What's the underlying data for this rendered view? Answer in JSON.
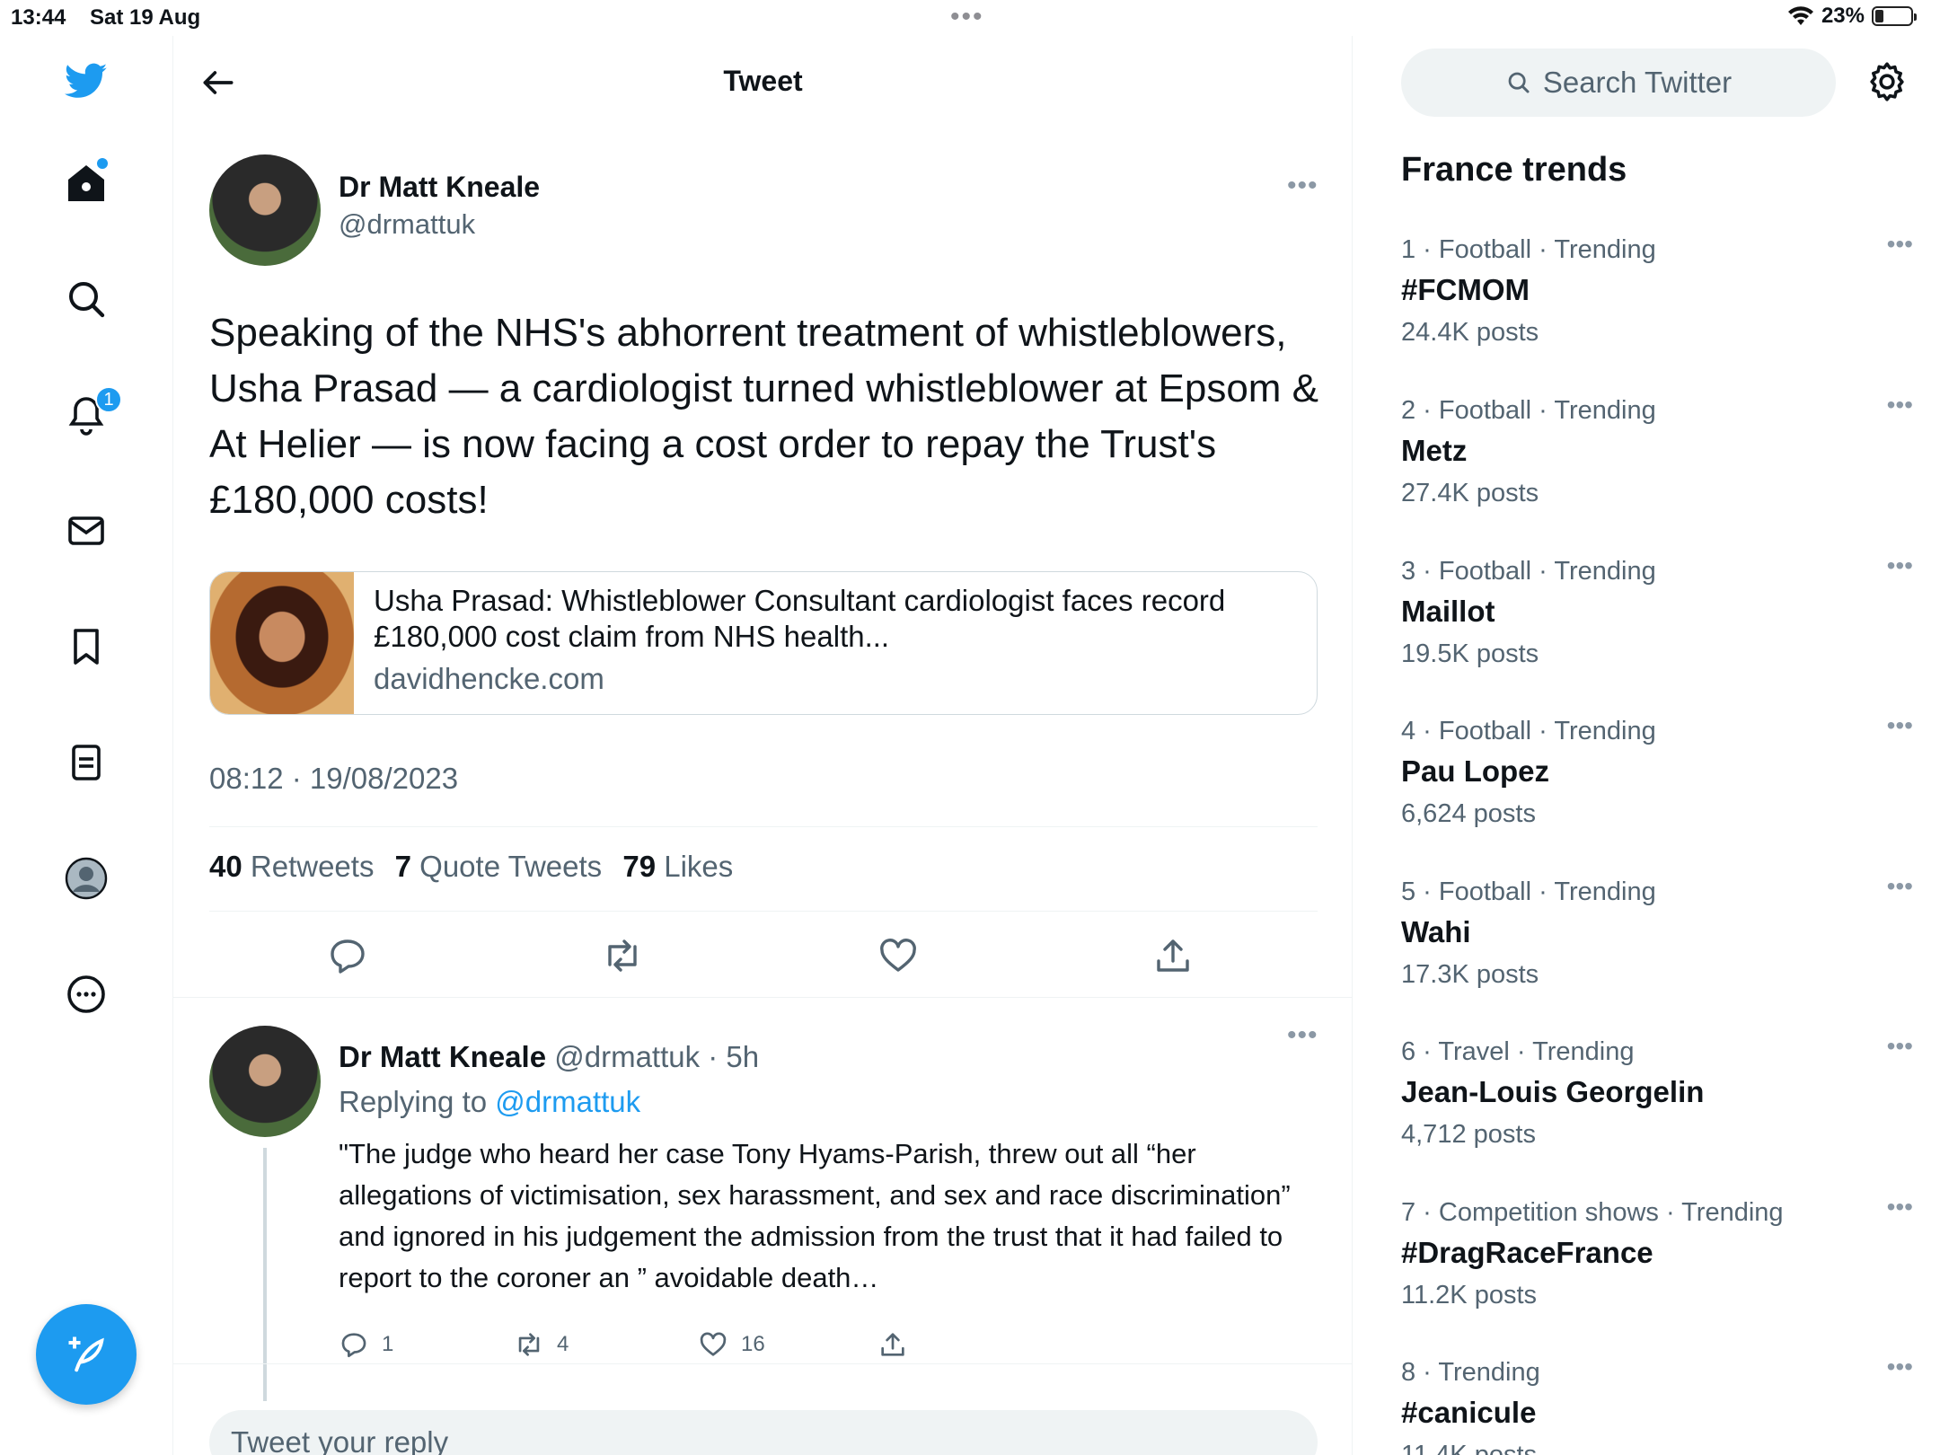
{
  "status_bar": {
    "time": "13:44",
    "date": "Sat 19 Aug",
    "battery": "23%",
    "battery_level": 0.23
  },
  "nav": {
    "notifications_badge": "1"
  },
  "header": {
    "title": "Tweet"
  },
  "tweet": {
    "author_name": "Dr Matt Kneale",
    "author_handle": "@drmattuk",
    "text": "Speaking of the NHS's abhorrent treatment of whistleblowers, Usha Prasad — a cardiologist turned whistleblower at Epsom & At Helier — is now facing a cost order to repay the Trust's £180,000 costs!",
    "card": {
      "title": "Usha Prasad: Whistleblower Consultant cardiologist faces record £180,000 cost claim from NHS health...",
      "domain": "davidhencke.com"
    },
    "timestamp": "08:12 · 19/08/2023",
    "retweets": "40",
    "retweets_label": "Retweets",
    "quotes": "7",
    "quotes_label": "Quote Tweets",
    "likes": "79",
    "likes_label": "Likes"
  },
  "reply": {
    "author_name": "Dr Matt Kneale",
    "meta": "@drmattuk · 5h",
    "replying_prefix": "Replying to",
    "replying_to": "@drmattuk",
    "text": "\"The judge who heard her case Tony Hyams-Parish, threw out all “her allegations of victimisation, sex harassment, and sex and race discrimination” and ignored in his judgement the admission from the trust that it had failed to report to the coroner an ” avoidable death…",
    "reply_count": "1",
    "retweet_count": "4",
    "like_count": "16"
  },
  "reply_box": {
    "placeholder": "Tweet your reply"
  },
  "sidebar": {
    "search_placeholder": "Search Twitter",
    "trends_title": "France trends",
    "trends": [
      {
        "rank": "1",
        "context": "1 · Football · Trending",
        "topic": "#FCMOM",
        "count": "24.4K posts"
      },
      {
        "rank": "2",
        "context": "2 · Football · Trending",
        "topic": "Metz",
        "count": "27.4K posts"
      },
      {
        "rank": "3",
        "context": "3 · Football · Trending",
        "topic": "Maillot",
        "count": "19.5K posts"
      },
      {
        "rank": "4",
        "context": "4 · Football · Trending",
        "topic": "Pau Lopez",
        "count": "6,624 posts"
      },
      {
        "rank": "5",
        "context": "5 · Football · Trending",
        "topic": "Wahi",
        "count": "17.3K posts"
      },
      {
        "rank": "6",
        "context": "6 · Travel · Trending",
        "topic": "Jean-Louis Georgelin",
        "count": "4,712 posts"
      },
      {
        "rank": "7",
        "context": "7 · Competition shows · Trending",
        "topic": "#DragRaceFrance",
        "count": "11.2K posts"
      },
      {
        "rank": "8",
        "context": "8 · Trending",
        "topic": "#canicule",
        "count": "11.4K posts"
      }
    ]
  },
  "colors": {
    "accent": "#1d9bf0",
    "text": "#0f1419",
    "secondary": "#536471",
    "border": "#eff3f4"
  }
}
